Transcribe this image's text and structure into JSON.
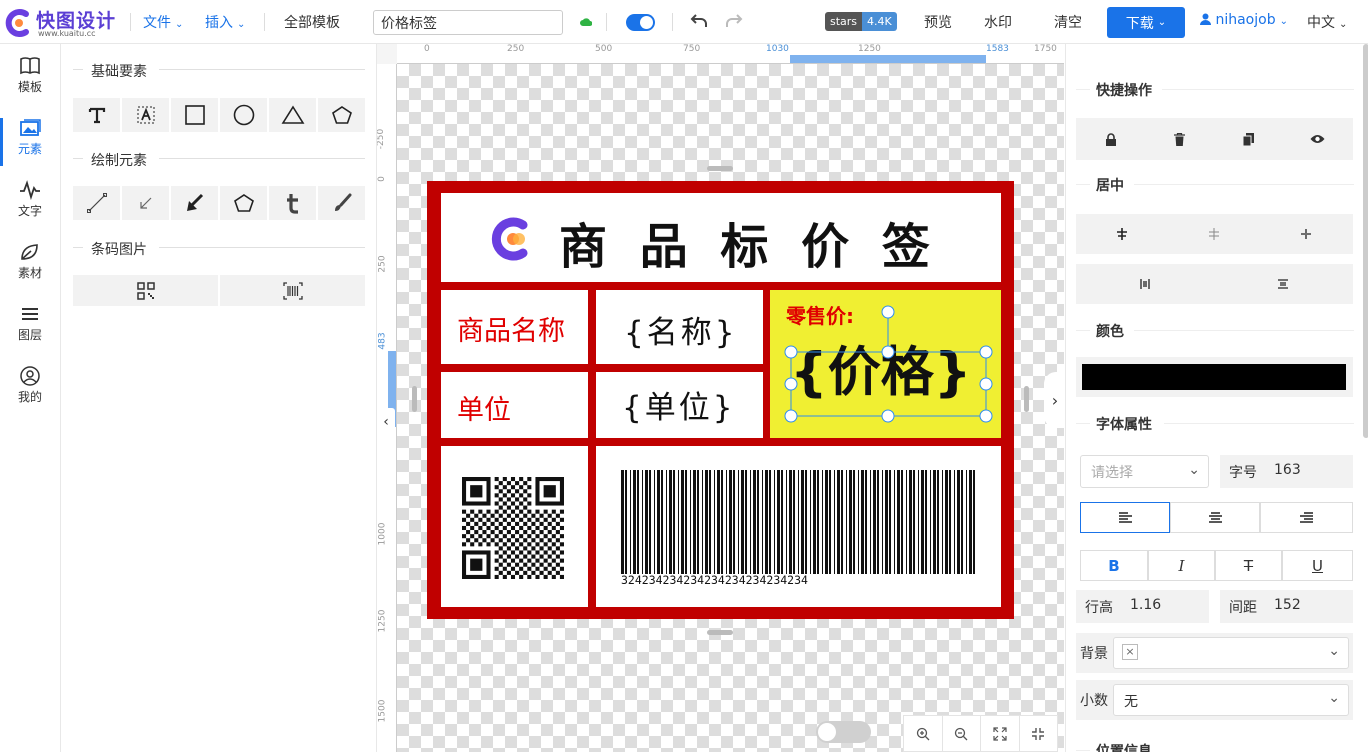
{
  "app": {
    "name": "快图设计",
    "site": "www.kuaitu.cc"
  },
  "topbar": {
    "file_menu": "文件",
    "insert_menu": "插入",
    "all_templates": "全部模板",
    "filename": "价格标签",
    "stars_label": "stars",
    "stars_count": "4.4K",
    "preview": "预览",
    "watermark": "水印",
    "clear": "清空",
    "download": "下载",
    "user": "nihaojob",
    "lang": "中文",
    "accent": "#1a73e8"
  },
  "nav": {
    "items": [
      {
        "label": "模板",
        "icon": "book-icon"
      },
      {
        "label": "元素",
        "icon": "image-icon"
      },
      {
        "label": "文字",
        "icon": "pulse-icon"
      },
      {
        "label": "素材",
        "icon": "leaf-icon"
      },
      {
        "label": "图层",
        "icon": "layers-icon"
      },
      {
        "label": "我的",
        "icon": "user-icon"
      }
    ]
  },
  "panel": {
    "basic_title": "基础要素",
    "draw_title": "绘制元素",
    "barcode_title": "条码图片"
  },
  "rulers": {
    "h_ticks": [
      "0",
      "250",
      "500",
      "750",
      "1030",
      "1250",
      "1583",
      "1750"
    ],
    "v_ticks": [
      "-250",
      "0",
      "250",
      "483",
      "1000",
      "1250",
      "1500"
    ]
  },
  "label": {
    "title": "商 品 标 价 签",
    "name_label": "商品名称",
    "name_value": "{名称}",
    "unit_label": "单位",
    "unit_value": "{单位}",
    "price_label": "零售价:",
    "price_value": "{价格}",
    "barcode_number": "324234234234234234234234234",
    "frame_color": "#c00000",
    "price_bg": "#f0ef32"
  },
  "props": {
    "quick_actions": "快捷操作",
    "center": "居中",
    "color": "颜色",
    "color_value": "#000000",
    "font_props": "字体属性",
    "font_select_placeholder": "请选择",
    "font_size_label": "字号",
    "font_size": "163",
    "line_height_label": "行高",
    "line_height": "1.16",
    "spacing_label": "间距",
    "spacing": "152",
    "bg_label": "背景",
    "decimal_label": "小数",
    "decimal_value": "无",
    "position_info": "位置信息"
  }
}
